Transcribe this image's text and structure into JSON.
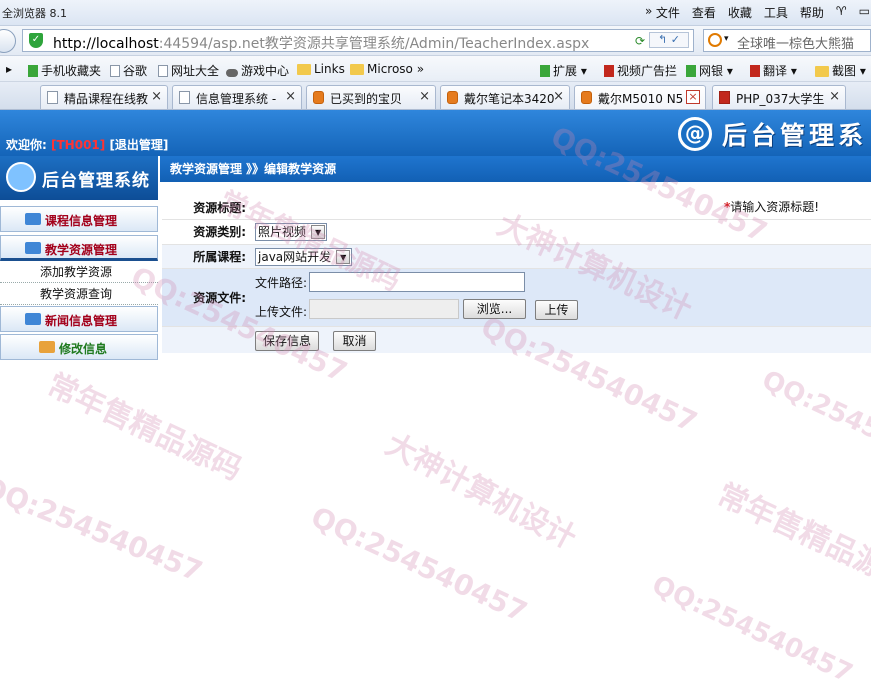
{
  "browser": {
    "title": "全浏览器 8.1",
    "menu": [
      "文件",
      "查看",
      "收藏",
      "工具",
      "帮助"
    ],
    "url_host": "http://localhost",
    "url_rest": ":44594/asp.net教学资源共享管理系统/Admin/TeacherIndex.aspx",
    "search_placeholder": "全球唯一棕色大熊猫",
    "favorites": [
      "手机收藏夹",
      "谷歌",
      "网址大全",
      "游戏中心",
      "Links",
      "Microso",
      "扩展",
      "视频广告拦",
      "网银",
      "翻译",
      "截图"
    ],
    "tabs": [
      {
        "label": "精品课程在线教",
        "close": "×"
      },
      {
        "label": "信息管理系统 -",
        "close": "×"
      },
      {
        "label": "已买到的宝贝",
        "close": "×"
      },
      {
        "label": "戴尔笔记本3420",
        "close": "×"
      },
      {
        "label": "戴尔M5010 N5",
        "close": "×"
      },
      {
        "label": "PHP_037大学生",
        "close": "×"
      }
    ]
  },
  "header": {
    "welcome_prefix": "欢迎你:",
    "user_id": "[TH001]",
    "logout": "[退出管理]",
    "brand_title": "后台管理系"
  },
  "sidebar": {
    "logo_title": "后台管理系统",
    "items": [
      {
        "label": "课程信息管理"
      },
      {
        "label": "教学资源管理"
      },
      {
        "label": "添加教学资源"
      },
      {
        "label": "教学资源查询"
      },
      {
        "label": "新闻信息管理"
      },
      {
        "label": "修改信息"
      }
    ]
  },
  "breadcrumb": "教学资源管理 》》编辑教学资源",
  "form": {
    "title_label": "资源标题:",
    "title_value": "",
    "title_required_star": "*",
    "title_hint": "请输入资源标题!",
    "type_label": "资源类别:",
    "type_selected": "照片视频",
    "course_label": "所属课程:",
    "course_selected": "java网站开发",
    "file_label": "资源文件:",
    "path_label": "文件路径:",
    "path_value": "",
    "upload_label": "上传文件:",
    "browse_button": "浏览...",
    "upload_button": "上传",
    "save_button": "保存信息",
    "cancel_button": "取消"
  },
  "watermark": {
    "qq": "QQ:254540457",
    "slogan1": "常年售精品源码",
    "slogan2": "大神计算机设计"
  }
}
